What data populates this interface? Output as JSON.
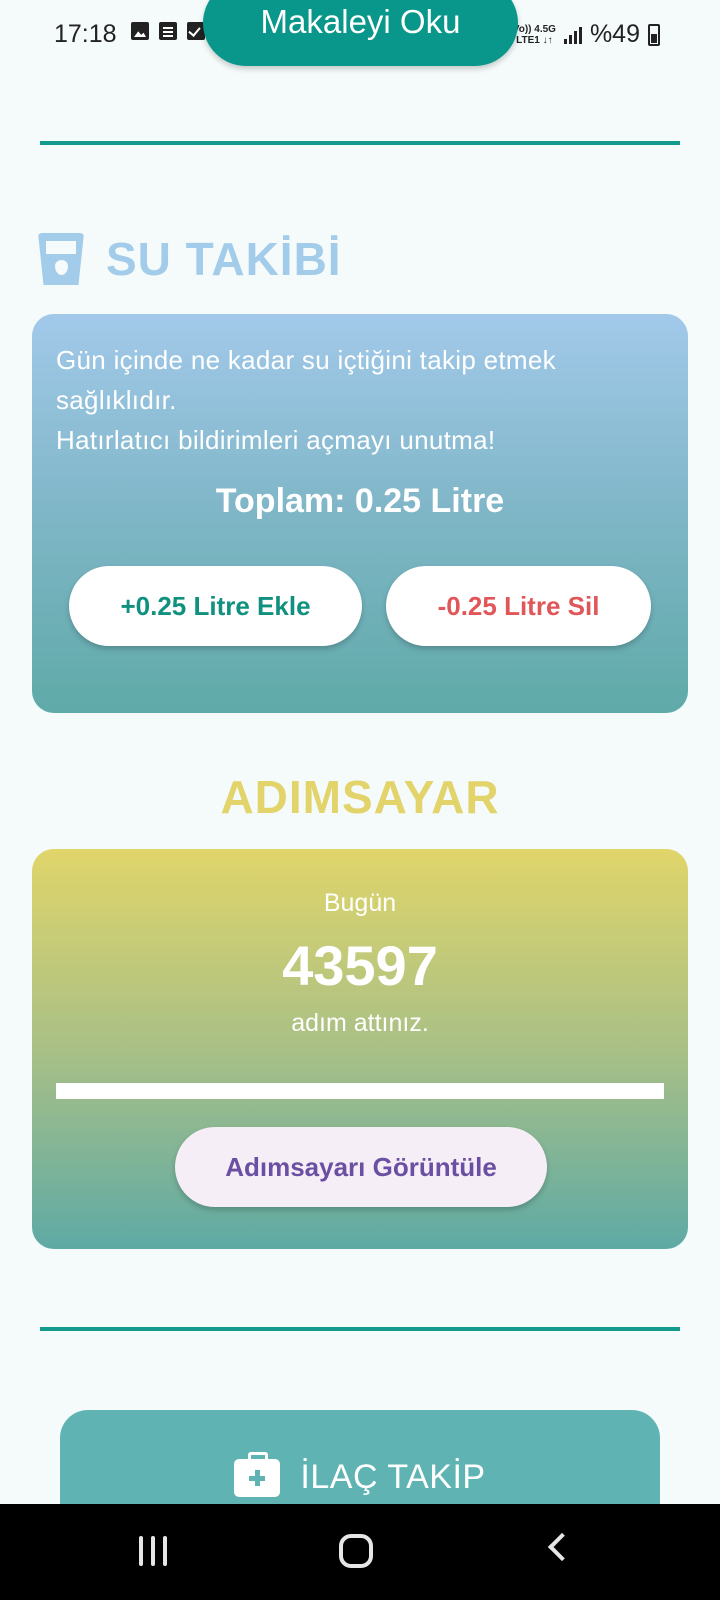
{
  "status_bar": {
    "time": "17:18",
    "network_top": "Vo)) 4.5G",
    "network_bottom": "LTE1 ↓↑",
    "battery_text": "%49"
  },
  "read_button": {
    "label": "Makaleyi Oku"
  },
  "water": {
    "title": "SU TAKİBİ",
    "description": "Gün içinde ne kadar su içtiğini takip etmek sağlıklıdır.\nHatırlatıcı bildirimleri açmayı unutma!",
    "total": "Toplam: 0.25 Litre",
    "add_label": "+0.25 Litre Ekle",
    "remove_label": "-0.25 Litre Sil"
  },
  "steps": {
    "title": "ADIMSAYAR",
    "today_label": "Bugün",
    "count": "43597",
    "suffix": "adım attınız.",
    "progress": 1.0,
    "button_label": "Adımsayarı Görüntüle"
  },
  "medication": {
    "label": "İLAÇ TAKİP"
  },
  "colors": {
    "primary": "#08978a",
    "water_title": "#a3ccea",
    "steps_title": "#e2d36a",
    "add_text": "#10907f",
    "remove_text": "#e05659",
    "steps_button_text": "#6b4fa2"
  }
}
